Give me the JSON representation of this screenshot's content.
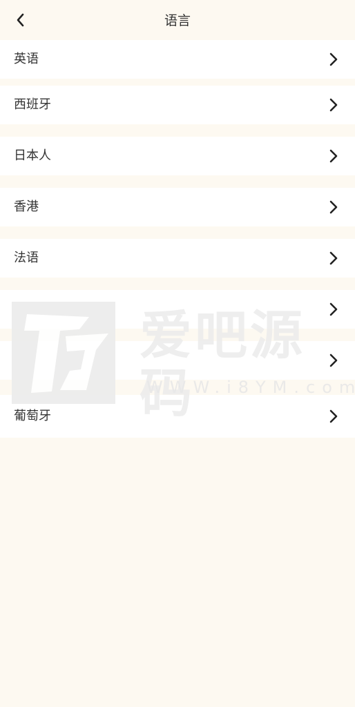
{
  "header": {
    "title": "语言",
    "back_icon": "chevron-left-icon"
  },
  "languages": [
    {
      "label": "英语"
    },
    {
      "label": "西班牙"
    },
    {
      "label": "日本人"
    },
    {
      "label": "香港"
    },
    {
      "label": "法语"
    },
    {
      "label": ""
    },
    {
      "label": ""
    },
    {
      "label": "葡萄牙"
    }
  ],
  "watermark": {
    "text": "爱吧源码",
    "url": "WWW.i8YM.com"
  },
  "colors": {
    "background": "#fdf9f1",
    "row": "#ffffff",
    "text": "#333333"
  }
}
